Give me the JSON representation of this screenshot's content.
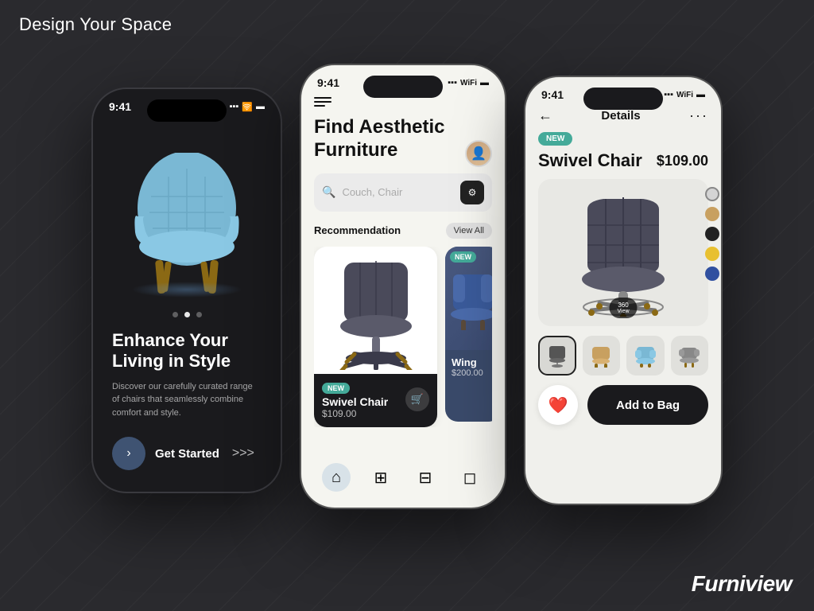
{
  "app": {
    "title": "Design Your Space",
    "brand": "Furniview"
  },
  "phone1": {
    "time": "9:41",
    "headline": "Enhance Your Living in Style",
    "subtext": "Discover our carefully curated range of chairs that seamlessly combine comfort and style.",
    "cta": "Get Started"
  },
  "phone2": {
    "time": "9:41",
    "title_line1": "Find Aesthetic",
    "title_line2": "Furniture",
    "search_placeholder": "Couch, Chair",
    "section_label": "Recommendation",
    "view_all": "View All",
    "product1": {
      "badge": "NEW",
      "name": "Swivel Chair",
      "price": "$109.00"
    },
    "product2": {
      "badge": "NEW",
      "name": "Wing",
      "price": "$200.00"
    }
  },
  "phone3": {
    "time": "9:41",
    "nav_title": "Details",
    "badge": "NEW",
    "product_name": "Swivel Chair",
    "product_price": "$109.00",
    "view_360": "360\nView",
    "add_to_bag": "Add to Bag",
    "colors": [
      "#d4d4d4",
      "#c8a060",
      "#222222",
      "#e8c030",
      "#3050a0"
    ],
    "thumbnails": [
      "🪑",
      "🪑",
      "🪑",
      "🪑"
    ]
  }
}
